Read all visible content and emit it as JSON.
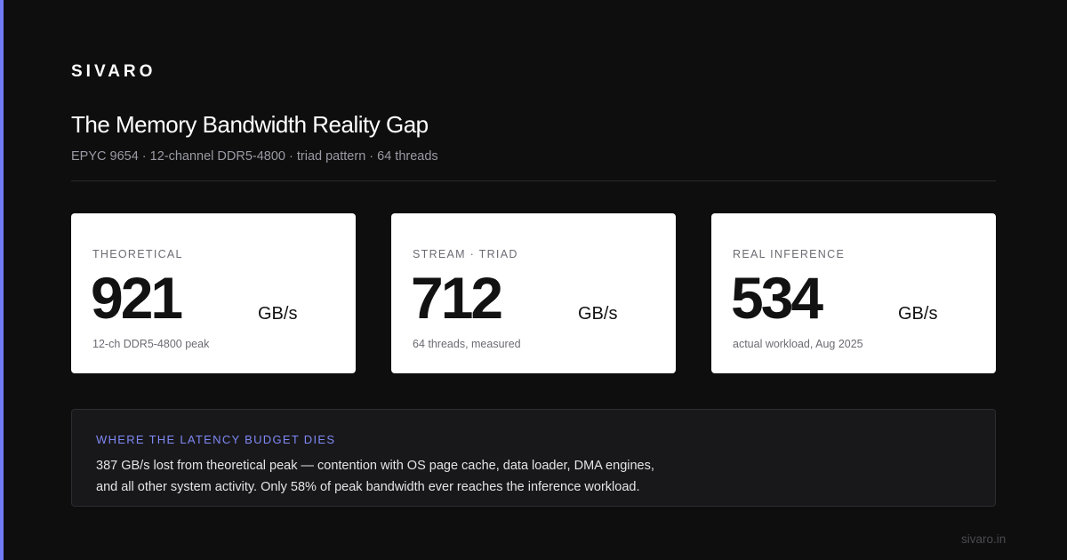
{
  "brand": "SIVARO",
  "title": "The Memory Bandwidth Reality Gap",
  "subtitle": "EPYC 9654 · 12-channel DDR5-4800 · triad pattern · 64 threads",
  "cards": [
    {
      "label": "THEORETICAL",
      "value": "921",
      "unit": "GB/s",
      "note": "12-ch DDR5-4800 peak"
    },
    {
      "label": "STREAM · TRIAD",
      "value": "712",
      "unit": "GB/s",
      "note": "64 threads, measured"
    },
    {
      "label": "REAL INFERENCE",
      "value": "534",
      "unit": "GB/s",
      "note": "actual workload, Aug 2025"
    }
  ],
  "callout": {
    "heading": "WHERE THE LATENCY BUDGET DIES",
    "line1": "387 GB/s lost from theoretical peak — contention with OS page cache, data loader, DMA engines,",
    "line2": "and all other system activity. Only 58% of peak bandwidth ever reaches the inference workload."
  },
  "footer": {
    "url": "sivaro.in"
  },
  "colors": {
    "accent": "#6f7bf7",
    "background": "#0e0e0f",
    "card": "#ffffff",
    "callout_heading": "#7f88f3"
  }
}
